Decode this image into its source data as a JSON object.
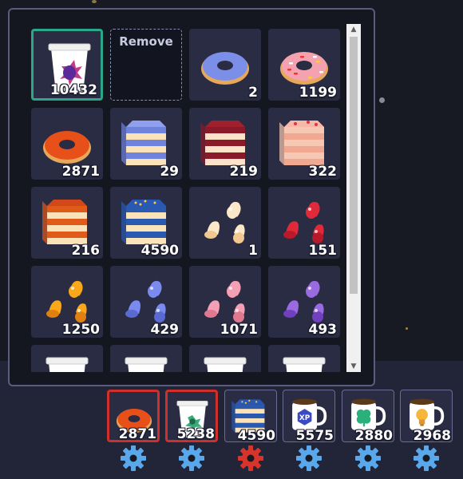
{
  "inventory": {
    "remove_label": "Remove",
    "rows": [
      [
        {
          "item": "empty-cup-purple-flower",
          "count": "10432",
          "selected": true
        },
        {
          "item": "remove-slot",
          "count": ""
        },
        {
          "item": "blue-donut",
          "count": "2"
        },
        {
          "item": "pink-sprinkle-donut",
          "count": "1199"
        },
        {
          "item": "orange-donut",
          "count": "2871"
        },
        {
          "item": "blue-layer-cake",
          "count": "29"
        },
        {
          "item": "red-velvet-layer-cake",
          "count": "219"
        },
        {
          "item": "strawberry-layer-cake",
          "count": "322"
        },
        {
          "item": "orange-layer-cake",
          "count": "216"
        },
        {
          "item": "blueberry-layer-cake",
          "count": "4590"
        },
        {
          "item": "white-gumdrops",
          "count": "1"
        },
        {
          "item": "red-gumdrops",
          "count": "151"
        },
        {
          "item": "orange-gumdrops",
          "count": "1250"
        },
        {
          "item": "blue-gumdrops",
          "count": "429"
        },
        {
          "item": "pink-gumdrops",
          "count": "1071"
        },
        {
          "item": "purple-gumdrops",
          "count": "493"
        },
        {
          "item": "empty-cup",
          "count": ""
        },
        {
          "item": "empty-cup",
          "count": ""
        },
        {
          "item": "empty-cup",
          "count": ""
        },
        {
          "item": "empty-cup",
          "count": ""
        }
      ]
    ]
  },
  "hotbar": [
    {
      "item": "orange-donut",
      "count": "2871",
      "active": true,
      "gear": "blue"
    },
    {
      "item": "empty-cup-green-leaf",
      "count": "5238",
      "active": true,
      "gear": "blue"
    },
    {
      "item": "blueberry-layer-cake",
      "count": "4590",
      "active": false,
      "gear": "red"
    },
    {
      "item": "xp-mug",
      "count": "5575",
      "active": false,
      "gear": "blue"
    },
    {
      "item": "clover-mug",
      "count": "2880",
      "active": false,
      "gear": "blue"
    },
    {
      "item": "lightbulb-mug",
      "count": "2968",
      "active": false,
      "gear": "blue"
    }
  ],
  "colors": {
    "panel_border": "#5b5c7e",
    "slot_bg": "#2a2c44",
    "selected_border": "#2aa889",
    "active_border": "#d0302c",
    "gear_blue": "#5aa8ec",
    "gear_red": "#d8342c"
  }
}
